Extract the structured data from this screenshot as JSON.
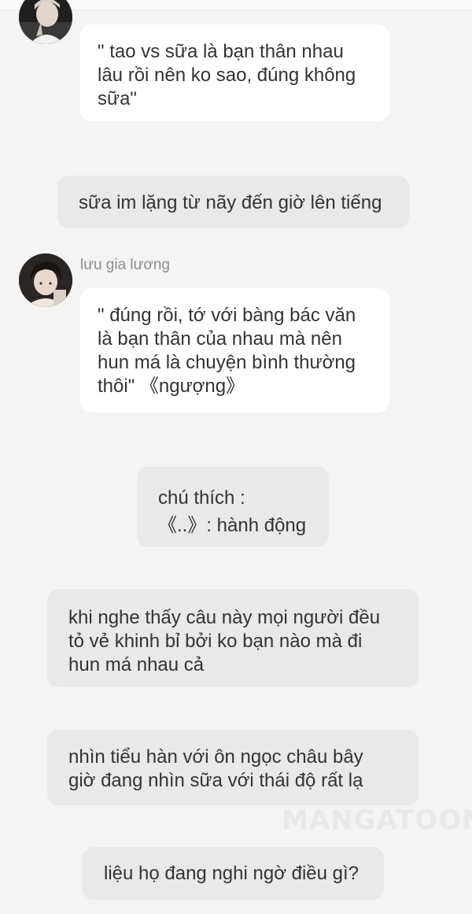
{
  "messages": [
    {
      "type": "character",
      "avatar_icon": "user-avatar-icon",
      "lines": [
        "\" tao vs sữa là bạn thân nhau",
        "lâu rồi nên ko sao, đúng không",
        "sữa\""
      ]
    },
    {
      "type": "narration",
      "lines": [
        "sữa im lặng từ nãy đến giờ lên tiếng"
      ]
    },
    {
      "type": "character",
      "avatar_icon": "user-avatar-icon",
      "name": "lưu gia lương",
      "lines": [
        "\" đúng rồi, tớ với bàng bác văn",
        "là bạn thân của nhau mà nên",
        "hun má là chuyện bình thường",
        "thôi\"  《ngượng》"
      ]
    },
    {
      "type": "narration",
      "lines": [
        "chú thích :",
        "《..》: hành động"
      ]
    },
    {
      "type": "narration",
      "lines": [
        "khi nghe thấy câu này mọi người đều",
        "tỏ vẻ khinh bỉ bởi ko bạn nào mà đi",
        "hun má nhau cả"
      ]
    },
    {
      "type": "narration",
      "lines": [
        "nhìn tiểu hàn với ôn ngọc châu bây",
        "giờ đang nhìn sữa với thái độ rất lạ"
      ]
    },
    {
      "type": "narration",
      "lines": [
        "liệu họ đang nghi ngờ điều gì?"
      ]
    }
  ],
  "watermark": "MANGATOON",
  "colors": {
    "page_background": "#f4f4f4",
    "character_bubble": "#ffffff",
    "narration_bubble": "#e9e9e9",
    "text": "#333333",
    "name_text": "#8c8c8c"
  }
}
